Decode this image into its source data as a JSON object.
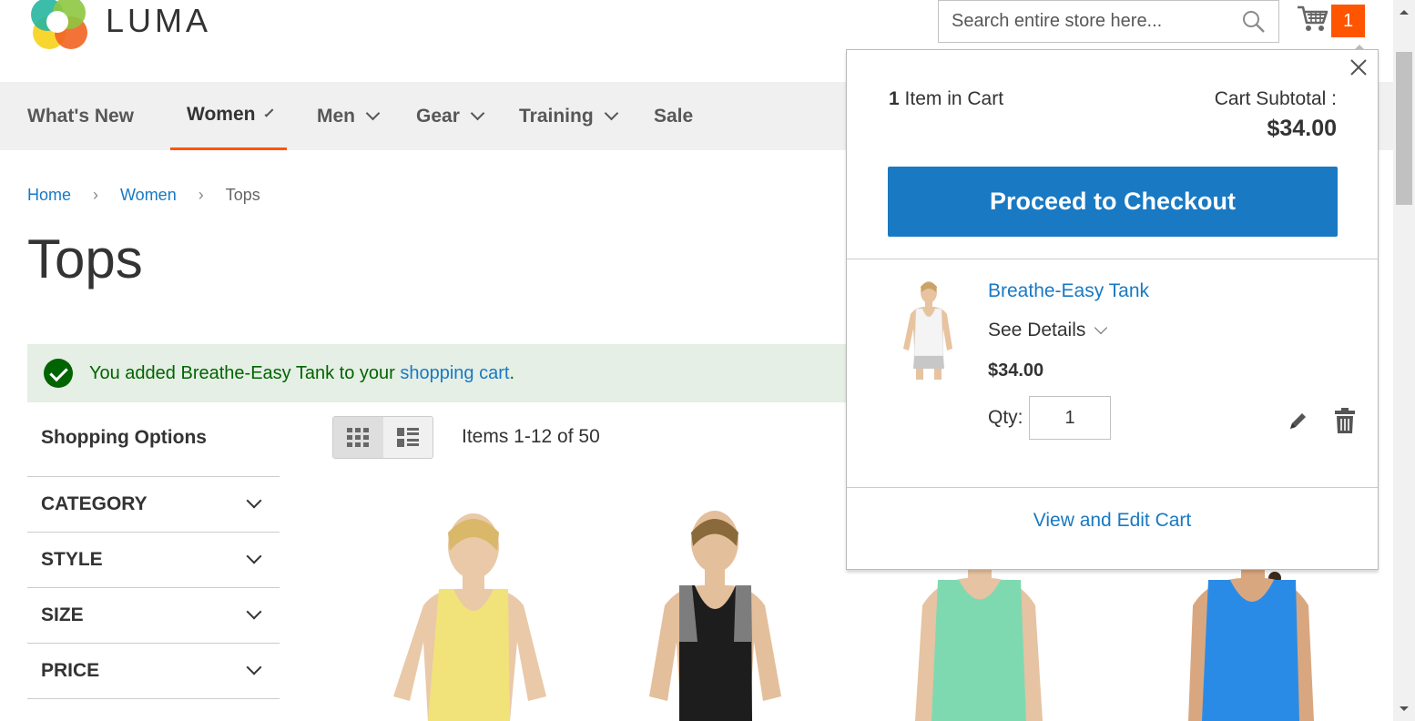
{
  "header": {
    "brand": "LUMA",
    "search_placeholder": "Search entire store here...",
    "cart_count": "1"
  },
  "nav": {
    "items": [
      {
        "label": "What's New"
      },
      {
        "label": "Women"
      },
      {
        "label": "Men"
      },
      {
        "label": "Gear"
      },
      {
        "label": "Training"
      },
      {
        "label": "Sale"
      }
    ]
  },
  "breadcrumb": {
    "home": "Home",
    "women": "Women",
    "current": "Tops"
  },
  "page_title": "Tops",
  "message": {
    "text": "You added Breathe-Easy Tank to your ",
    "link": "shopping cart",
    "end": "."
  },
  "sidebar": {
    "title": "Shopping Options",
    "filters": [
      "CATEGORY",
      "STYLE",
      "SIZE",
      "PRICE"
    ]
  },
  "toolbar": {
    "items_count": "Items 1-12 of 50"
  },
  "products": {
    "colors": [
      "#f2e27a",
      "#1d1d1d",
      "#7fd9b0",
      "#2a8be6"
    ]
  },
  "minicart": {
    "count_num": "1",
    "count_text": " Item in Cart",
    "subtotal_label": "Cart Subtotal :",
    "subtotal_value": "$34.00",
    "checkout_label": "Proceed to Checkout",
    "item": {
      "name": "Breathe-Easy Tank",
      "details_label": "See Details",
      "price": "$34.00",
      "qty_label": "Qty:",
      "qty_value": "1"
    },
    "view_cart_label": "View and Edit Cart"
  },
  "colors": {
    "accent": "#ff5501",
    "link": "#1979c3",
    "success": "#006400"
  }
}
